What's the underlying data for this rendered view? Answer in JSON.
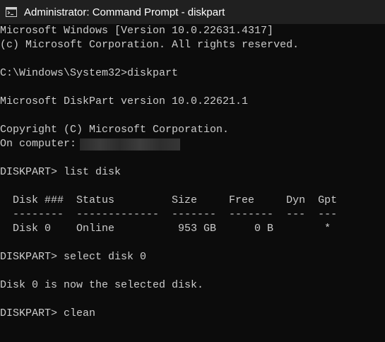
{
  "window": {
    "title": "Administrator: Command Prompt - diskpart",
    "icon": "cmd-icon"
  },
  "console": {
    "lines": [
      "Microsoft Windows [Version 10.0.22631.4317]",
      "(c) Microsoft Corporation. All rights reserved.",
      "",
      "C:\\Windows\\System32>diskpart",
      "",
      "Microsoft DiskPart version 10.0.22621.1",
      "",
      "Copyright (C) Microsoft Corporation.",
      "On computer: ",
      "",
      "DISKPART> list disk",
      "",
      "  Disk ###  Status         Size     Free     Dyn  Gpt",
      "  --------  -------------  -------  -------  ---  ---",
      "  Disk 0    Online          953 GB      0 B        *",
      "",
      "DISKPART> select disk 0",
      "",
      "Disk 0 is now the selected disk.",
      "",
      "DISKPART> clean"
    ],
    "redacted_field": "computer-name-redacted"
  },
  "colors": {
    "background": "#0c0c0c",
    "text": "#cccccc",
    "titlebar": "#202020",
    "title_text": "#ffffff"
  }
}
